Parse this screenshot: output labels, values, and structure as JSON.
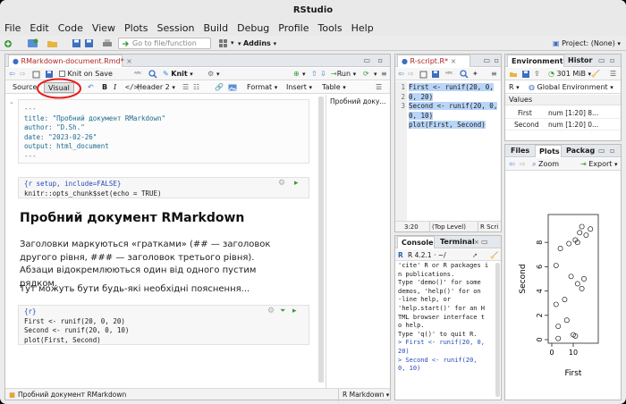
{
  "window": {
    "title": "RStudio"
  },
  "menu": [
    "File",
    "Edit",
    "Code",
    "View",
    "Plots",
    "Session",
    "Build",
    "Debug",
    "Profile",
    "Tools",
    "Help"
  ],
  "toolbar": {
    "goto_placeholder": "Go to file/function",
    "addins": "Addins",
    "project": "Project: (None)"
  },
  "source_pane": {
    "tab_label": "RMarkdown-document.Rmd*",
    "knit_on_save": "Knit on Save",
    "knit": "Knit",
    "run": "Run",
    "source_btn": "Source",
    "visual_btn": "Visual",
    "bold": "B",
    "italic": "I",
    "header_select": "Header 2",
    "format_menu": "Format",
    "insert_menu": "Insert",
    "table_menu": "Table",
    "outline": "Пробний доку...",
    "yaml": [
      "---",
      "title: \"Пробний документ RMarkdown\"",
      "author: \"D.Sh.\"",
      "date: \"2023-02-26\"",
      "output: html_document",
      "---"
    ],
    "setup_chunk": [
      "{r setup, include=FALSE}",
      "knitr::opts_chunk$set(echo = TRUE)"
    ],
    "heading": "Пробний документ RMarkdown",
    "para1": "Заголовки маркуються «гратками» (## — заголовок другого рівня, ### — заголовок третього рівня). Абзаци відокремлюються один від одного пустим рядком.",
    "para2": "Тут можуть бути будь-які необхідні пояснення...",
    "r_chunk": [
      "{r}",
      "First <- runif(20, 0, 20)",
      "Second <- runif(20, 0, 10)",
      "plot(First, Second)"
    ],
    "status_left": "Пробний документ RMarkdown",
    "status_right": "R Markdown"
  },
  "script_pane": {
    "tab_label": "R-script.R*",
    "line_numbers": [
      "1",
      "",
      "2",
      "",
      "3"
    ],
    "lines": [
      "First <- runif(20, 0,",
      "0, 20)",
      "Second <- runif(20, 0,",
      "0, 10)",
      "plot(First, Second)"
    ],
    "status_pos": "3:20",
    "status_level": "(Top Level)",
    "status_type": "R Scri"
  },
  "console_pane": {
    "tab_console": "Console",
    "tab_terminal": "Terminal",
    "r_version": "R 4.2.1 · ~/",
    "lines": [
      "'cite' R or R packages i",
      "n publications.",
      "",
      "Type 'demo()' for some",
      "demos, 'help()' for on",
      "-line help, or",
      "'help.start()' for an H",
      "TML browser interface t",
      "o help.",
      "Type 'q()' to quit R.",
      ""
    ],
    "input_lines": [
      "> First <- runif(20, 0,",
      "20)",
      "> Second <- runif(20,",
      "0, 10)"
    ]
  },
  "env_pane": {
    "tab_environment": "Environment",
    "tab_history": "Histor",
    "memory": "301 MiB",
    "lang": "R",
    "scope": "Global Environment",
    "section": "Values",
    "rows": [
      {
        "name": "First",
        "value": "num [1:20] 8..."
      },
      {
        "name": "Second",
        "value": "num [1:20] 0..."
      }
    ]
  },
  "files_pane": {
    "tab_files": "Files",
    "tab_plots": "Plots",
    "tab_packages": "Packag",
    "zoom": "Zoom",
    "export": "Export"
  },
  "chart_data": {
    "type": "scatter",
    "xlabel": "First",
    "ylabel": "Second",
    "xticks": [
      0,
      10
    ],
    "yticks": [
      0,
      2,
      4,
      6,
      8
    ],
    "xlim": [
      0,
      20
    ],
    "ylim": [
      0,
      10
    ],
    "x": [
      14,
      18,
      13,
      11,
      12,
      4,
      8,
      16,
      2,
      9,
      15,
      12,
      14,
      6,
      2,
      7,
      3,
      10,
      11,
      3
    ],
    "y": [
      9.3,
      9.1,
      8.8,
      8.2,
      8.0,
      7.5,
      7.9,
      8.6,
      6.1,
      5.2,
      5.0,
      4.6,
      4.2,
      3.3,
      2.9,
      1.6,
      1.1,
      0.4,
      0.3,
      0.1
    ]
  }
}
